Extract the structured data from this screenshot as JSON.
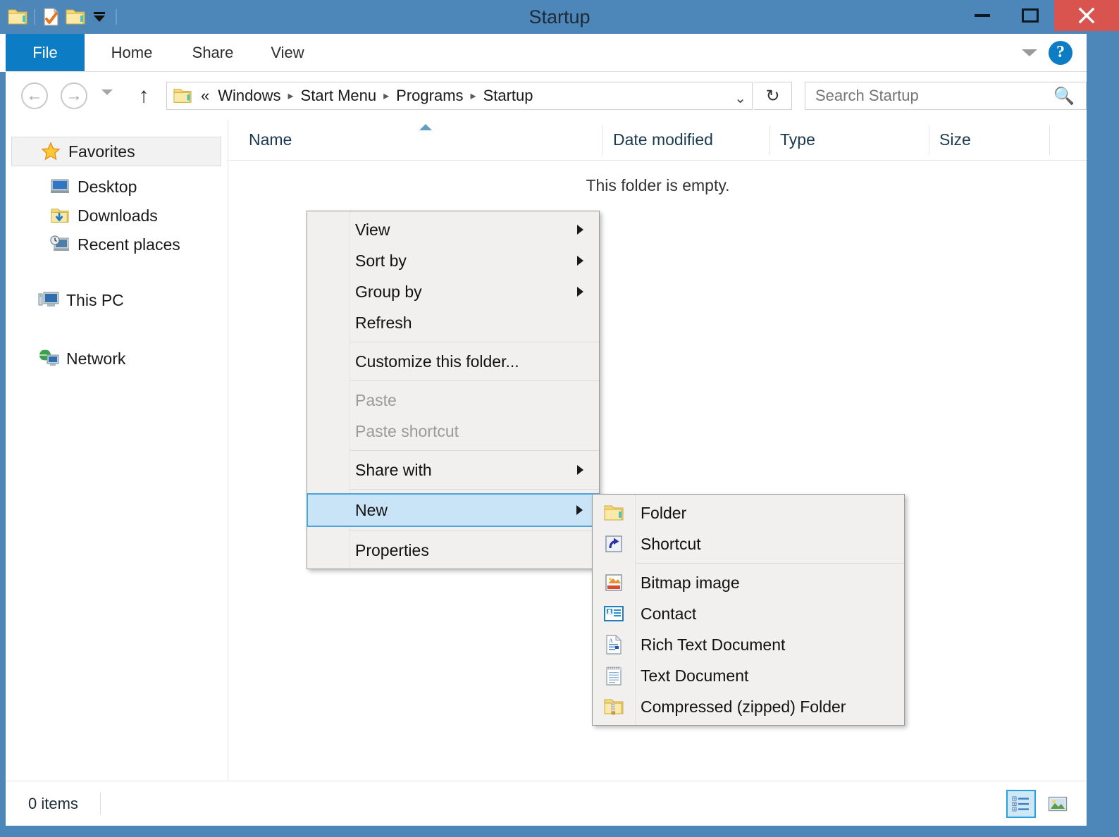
{
  "window": {
    "title": "Startup",
    "controls": {
      "minimize": "minimize",
      "maximize": "maximize",
      "close": "close"
    }
  },
  "quick_access": {
    "items": [
      {
        "name": "properties-folder-icon",
        "label": "Properties"
      },
      {
        "name": "new-folder-icon",
        "label": "New folder"
      },
      {
        "name": "customize-icon",
        "label": "Customize Quick Access Toolbar"
      }
    ]
  },
  "ribbon": {
    "tabs": [
      {
        "label": "File",
        "active": true
      },
      {
        "label": "Home",
        "active": false
      },
      {
        "label": "Share",
        "active": false
      },
      {
        "label": "View",
        "active": false
      }
    ],
    "minimize_ribbon": "Minimize the Ribbon",
    "help": "?"
  },
  "address_bar": {
    "back": "Back",
    "forward": "Forward",
    "recent_locations": "Recent locations",
    "up": "Up",
    "crumbs": [
      "«",
      "Windows",
      "Start Menu",
      "Programs",
      "Startup"
    ],
    "separator": "▸",
    "dropdown": "⌄",
    "refresh": "↻"
  },
  "search": {
    "placeholder": "Search Startup",
    "icon": "search-icon"
  },
  "sidebar": {
    "groups": [
      {
        "label": "Favorites",
        "icon": "star-icon",
        "selected": true,
        "items": [
          {
            "label": "Desktop",
            "icon": "desktop-icon"
          },
          {
            "label": "Downloads",
            "icon": "downloads-folder-icon"
          },
          {
            "label": "Recent places",
            "icon": "recent-places-icon"
          }
        ]
      },
      {
        "label": "This PC",
        "icon": "computer-icon",
        "items": []
      },
      {
        "label": "Network",
        "icon": "network-icon",
        "items": []
      }
    ]
  },
  "file_list": {
    "columns": [
      {
        "label": "Name",
        "sorted": true,
        "sort_direction": "asc"
      },
      {
        "label": "Date modified",
        "sorted": false
      },
      {
        "label": "Type",
        "sorted": false
      },
      {
        "label": "Size",
        "sorted": false
      }
    ],
    "empty_message": "This folder is empty.",
    "rows": []
  },
  "status_bar": {
    "item_count": "0 items",
    "views": [
      {
        "name": "details-view-button",
        "label": "Details view",
        "active": true
      },
      {
        "name": "large-icons-view-button",
        "label": "Large icons view",
        "active": false
      }
    ]
  },
  "context_menu": {
    "items": [
      {
        "label": "View",
        "submenu": true,
        "disabled": false,
        "highlight": false
      },
      {
        "label": "Sort by",
        "submenu": true,
        "disabled": false,
        "highlight": false
      },
      {
        "label": "Group by",
        "submenu": true,
        "disabled": false,
        "highlight": false
      },
      {
        "label": "Refresh",
        "submenu": false,
        "disabled": false,
        "highlight": false
      },
      {
        "separator": true
      },
      {
        "label": "Customize this folder...",
        "submenu": false,
        "disabled": false,
        "highlight": false
      },
      {
        "separator": true
      },
      {
        "label": "Paste",
        "submenu": false,
        "disabled": true,
        "highlight": false
      },
      {
        "label": "Paste shortcut",
        "submenu": false,
        "disabled": true,
        "highlight": false
      },
      {
        "separator": true
      },
      {
        "label": "Share with",
        "submenu": true,
        "disabled": false,
        "highlight": false
      },
      {
        "separator": true
      },
      {
        "label": "New",
        "submenu": true,
        "disabled": false,
        "highlight": true
      },
      {
        "separator": true
      },
      {
        "label": "Properties",
        "submenu": false,
        "disabled": false,
        "highlight": false
      }
    ]
  },
  "new_submenu": {
    "items": [
      {
        "label": "Folder",
        "icon": "folder-icon"
      },
      {
        "label": "Shortcut",
        "icon": "shortcut-icon"
      },
      {
        "separator": true
      },
      {
        "label": "Bitmap image",
        "icon": "bitmap-image-icon"
      },
      {
        "label": "Contact",
        "icon": "contact-icon"
      },
      {
        "label": "Rich Text Document",
        "icon": "rich-text-document-icon"
      },
      {
        "label": "Text Document",
        "icon": "text-document-icon"
      },
      {
        "label": "Compressed (zipped) Folder",
        "icon": "zipped-folder-icon"
      }
    ]
  },
  "colors": {
    "title_bar": "#4d86b8",
    "file_tab": "#0c7dc4",
    "close_button": "#d9534f",
    "highlight": "#c9e4f7",
    "highlight_border": "#4ba3dd",
    "menu_bg": "#f1f0ef"
  }
}
